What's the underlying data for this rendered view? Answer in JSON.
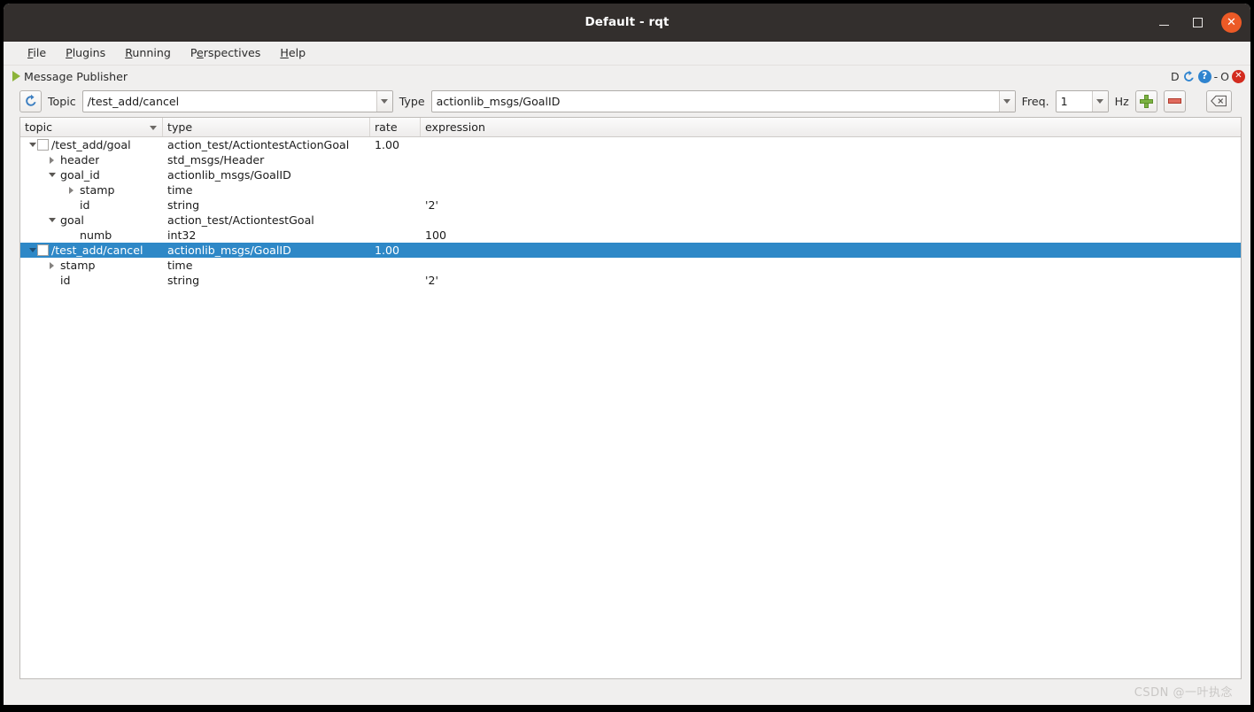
{
  "window": {
    "title": "Default - rqt",
    "controls": {
      "minimize": "minimize-button",
      "maximize": "maximize-button",
      "close": "✕"
    }
  },
  "menubar": {
    "items": [
      {
        "label": "File",
        "mnemonic": "F",
        "pre": "",
        "post": "ile"
      },
      {
        "label": "Plugins",
        "mnemonic": "P",
        "pre": "",
        "post": "lugins"
      },
      {
        "label": "Running",
        "mnemonic": "R",
        "pre": "",
        "post": "unning"
      },
      {
        "label": "Perspectives",
        "mnemonic": "e",
        "pre": "P",
        "post": "rspectives"
      },
      {
        "label": "Help",
        "mnemonic": "H",
        "pre": "",
        "post": "elp"
      }
    ]
  },
  "plugin_bar": {
    "title": "Message Publisher",
    "dock_label": "D",
    "separator": "-",
    "float_label": "O",
    "help_glyph": "?",
    "close_glyph": "✕"
  },
  "toolbar": {
    "refresh_icon": "refresh-icon",
    "topic_label": "Topic",
    "topic_value": "/test_add/cancel",
    "type_label": "Type",
    "type_value": "actionlib_msgs/GoalID",
    "freq_label": "Freq.",
    "freq_value": "1",
    "hz_label": "Hz",
    "add_label": "add-publisher-button",
    "remove_label": "remove-publisher-button",
    "clear_label": "clear-button"
  },
  "tree": {
    "columns": [
      {
        "key": "topic",
        "label": "topic",
        "sorted": true
      },
      {
        "key": "type",
        "label": "type",
        "sorted": false
      },
      {
        "key": "rate",
        "label": "rate",
        "sorted": false
      },
      {
        "key": "expression",
        "label": "expression",
        "sorted": false
      }
    ],
    "rows": [
      {
        "indent": 0,
        "twisty": "open",
        "checkbox": true,
        "topic": "/test_add/goal",
        "type": "action_test/ActiontestActionGoal",
        "rate": "1.00",
        "expression": "",
        "selected": false
      },
      {
        "indent": 1,
        "twisty": "closed",
        "checkbox": false,
        "topic": "header",
        "type": "std_msgs/Header",
        "rate": "",
        "expression": "",
        "selected": false
      },
      {
        "indent": 1,
        "twisty": "open",
        "checkbox": false,
        "topic": "goal_id",
        "type": "actionlib_msgs/GoalID",
        "rate": "",
        "expression": "",
        "selected": false
      },
      {
        "indent": 2,
        "twisty": "closed",
        "checkbox": false,
        "topic": "stamp",
        "type": "time",
        "rate": "",
        "expression": "",
        "selected": false
      },
      {
        "indent": 2,
        "twisty": "none",
        "checkbox": false,
        "topic": "id",
        "type": "string",
        "rate": "",
        "expression": "'2'",
        "selected": false
      },
      {
        "indent": 1,
        "twisty": "open",
        "checkbox": false,
        "topic": "goal",
        "type": "action_test/ActiontestGoal",
        "rate": "",
        "expression": "",
        "selected": false
      },
      {
        "indent": 2,
        "twisty": "none",
        "checkbox": false,
        "topic": "numb",
        "type": "int32",
        "rate": "",
        "expression": "100",
        "selected": false
      },
      {
        "indent": 0,
        "twisty": "open",
        "checkbox": true,
        "topic": "/test_add/cancel",
        "type": "actionlib_msgs/GoalID",
        "rate": "1.00",
        "expression": "",
        "selected": true
      },
      {
        "indent": 1,
        "twisty": "closed",
        "checkbox": false,
        "topic": "stamp",
        "type": "time",
        "rate": "",
        "expression": "",
        "selected": false
      },
      {
        "indent": 1,
        "twisty": "none",
        "checkbox": false,
        "topic": "id",
        "type": "string",
        "rate": "",
        "expression": "'2'",
        "selected": false
      }
    ]
  },
  "watermark": {
    "text": "CSDN @一叶执念"
  },
  "colors": {
    "selection": "#2e88c7",
    "titlebar": "#332f2d",
    "close_button": "#ec5a26",
    "accent_green": "#7cb342",
    "accent_red": "#e06b5e"
  }
}
